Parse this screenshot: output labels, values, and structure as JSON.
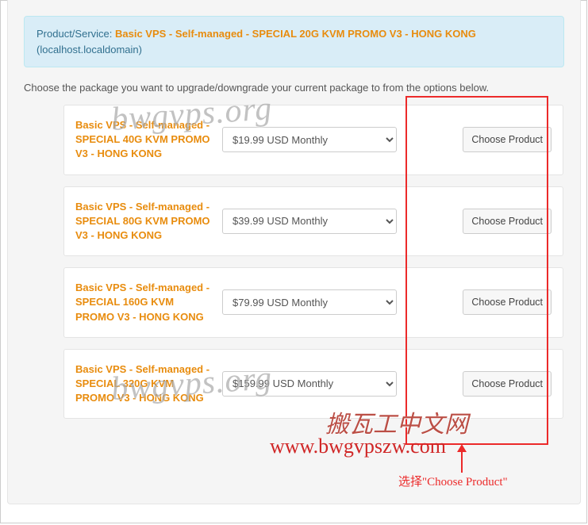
{
  "info": {
    "prefix": "Product/Service: ",
    "product": "Basic VPS - Self-managed - SPECIAL 20G KVM PROMO V3 - HONG KONG",
    "host": "(localhost.localdomain)"
  },
  "instructions": "Choose the package you want to upgrade/downgrade your current package to from the options below.",
  "packages": [
    {
      "name": "Basic VPS - Self-managed - SPECIAL 40G KVM PROMO V3 - HONG KONG",
      "price": "$19.99 USD Monthly",
      "button": "Choose Product"
    },
    {
      "name": "Basic VPS - Self-managed - SPECIAL 80G KVM PROMO V3 - HONG KONG",
      "price": "$39.99 USD Monthly",
      "button": "Choose Product"
    },
    {
      "name": "Basic VPS - Self-managed - SPECIAL 160G KVM PROMO V3 - HONG KONG",
      "price": "$79.99 USD Monthly",
      "button": "Choose Product"
    },
    {
      "name": "Basic VPS - Self-managed - SPECIAL 320G KVM PROMO V3 - HONG KONG",
      "price": "$159.99 USD Monthly",
      "button": "Choose Product"
    }
  ],
  "annotation": {
    "label": "选择\"Choose Product\""
  },
  "watermarks": {
    "wm1": "bwgvps.org",
    "wm2": "bwgvps.org",
    "cn": "搬瓦工中文网",
    "url": "www.bwgvpszw.com"
  }
}
